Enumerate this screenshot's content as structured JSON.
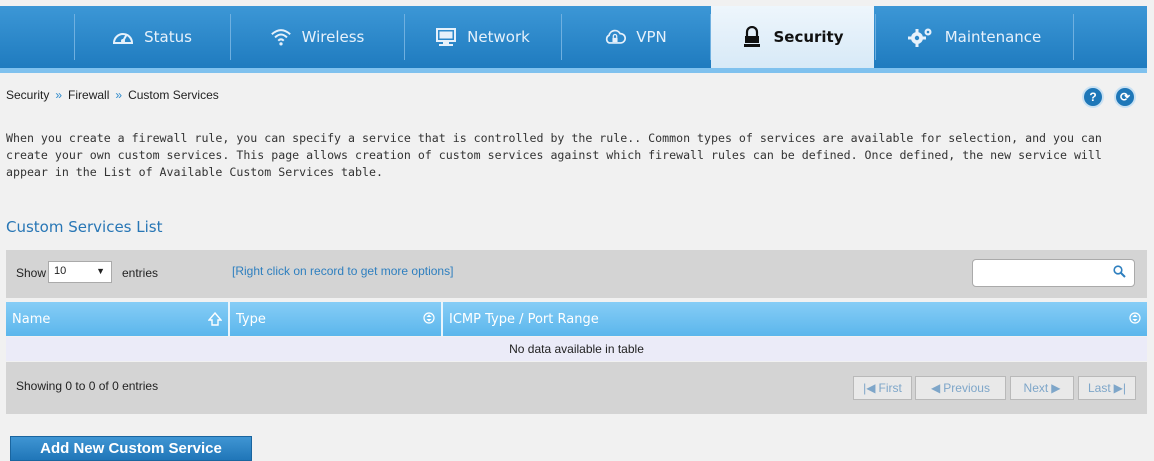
{
  "nav": {
    "items": [
      {
        "label": "Status",
        "icon": "gauge-icon"
      },
      {
        "label": "Wireless",
        "icon": "wifi-icon"
      },
      {
        "label": "Network",
        "icon": "monitor-icon"
      },
      {
        "label": "VPN",
        "icon": "cloud-lock-icon"
      },
      {
        "label": "Security",
        "icon": "lock-icon",
        "active": true
      },
      {
        "label": "Maintenance",
        "icon": "gears-icon"
      }
    ]
  },
  "breadcrumb": {
    "level1": "Security",
    "level2": "Firewall",
    "level3": "Custom Services",
    "separator": "»"
  },
  "help": {
    "help_label": "?",
    "refresh_label": "⟳"
  },
  "description": "When you create a firewall rule, you can specify a service that is controlled by the rule.. Common types of services are available for selection, and you can create your own custom services. This page allows creation of custom services against which firewall rules can be defined. Once defined, the new service will appear in the List of Available Custom Services table.",
  "section_title": "Custom Services List",
  "toolbar": {
    "show_label": "Show",
    "show_value": "10",
    "entries_label": "entries",
    "right_click_hint": "[Right click on record to get more options]",
    "search_value": ""
  },
  "table": {
    "columns": [
      "Name",
      "Type",
      "ICMP Type / Port Range"
    ],
    "empty_message": "No data available in table",
    "info": "Showing 0 to 0 of 0 entries"
  },
  "pagination": {
    "first": "First",
    "previous": "Previous",
    "next": "Next",
    "last": "Last"
  },
  "add_button": "Add New Custom Service",
  "colors": {
    "nav": "#2a87c9",
    "header": "#6fc2f3",
    "accent": "#2776b5"
  }
}
